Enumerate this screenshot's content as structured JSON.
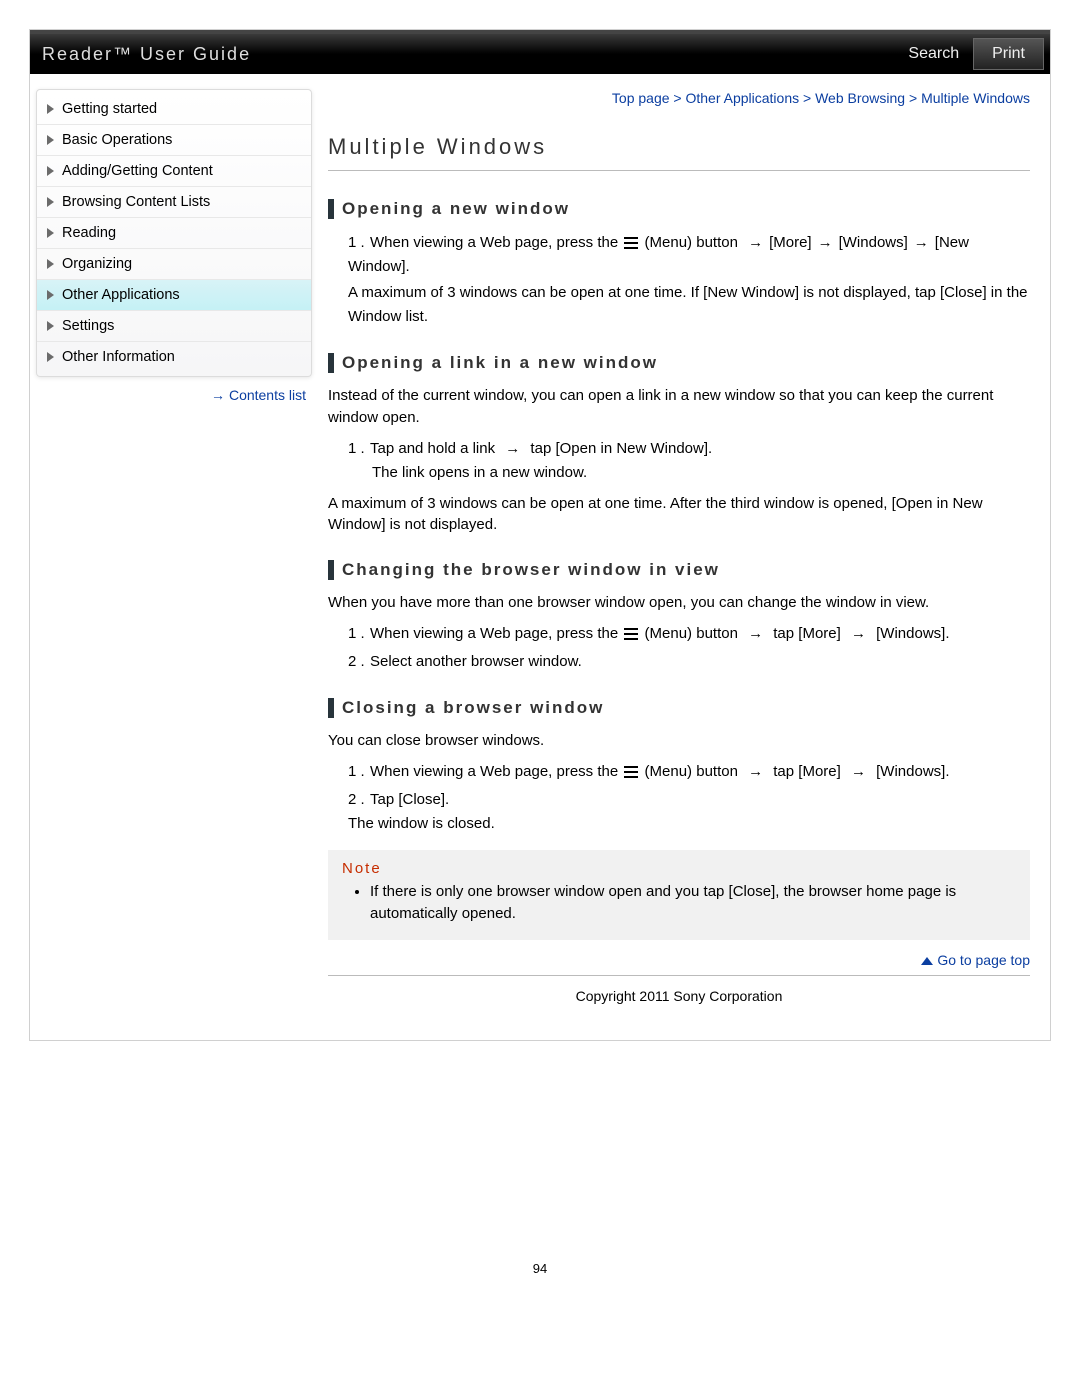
{
  "header": {
    "title": "Reader™ User Guide",
    "search": "Search",
    "print": "Print"
  },
  "breadcrumb": {
    "p0": "Top page",
    "p1": "Other Applications",
    "p2": "Web Browsing",
    "p3": "Multiple Windows",
    "sep": " > "
  },
  "nav": {
    "items": [
      {
        "label": "Getting started"
      },
      {
        "label": "Basic Operations"
      },
      {
        "label": "Adding/Getting Content"
      },
      {
        "label": "Browsing Content Lists"
      },
      {
        "label": "Reading"
      },
      {
        "label": "Organizing"
      },
      {
        "label": "Other Applications"
      },
      {
        "label": "Settings"
      },
      {
        "label": "Other Information"
      }
    ],
    "contents_list": "Contents list"
  },
  "main": {
    "title": "Multiple Windows",
    "s1": {
      "h": "Opening a new window",
      "step1a": "When viewing a Web page, press the ",
      "step1b": " (Menu) button ",
      "more": "[More]",
      "windows": "[Windows]",
      "newwin": "[New Window].",
      "after": "A maximum of 3 windows can be open at one time. If [New Window] is not displayed, tap [Close] in the Window list."
    },
    "s2": {
      "h": "Opening a link in a new window",
      "intro": "Instead of the current window, you can open a link in a new window so that you can keep the current window open.",
      "step1a": "Tap and hold a link ",
      "step1b": " tap [Open in New Window].",
      "sub": "The link opens in a new window.",
      "after": "A maximum of 3 windows can be open at one time. After the third window is opened, [Open in New Window] is not displayed."
    },
    "s3": {
      "h": "Changing the browser window in view",
      "intro": "When you have more than one browser window open, you can change the window in view.",
      "step1a": "When viewing a Web page, press the ",
      "step1b": " (Menu) button ",
      "tapmore": " tap [More] ",
      "windows": " [Windows].",
      "step2": "Select another browser window."
    },
    "s4": {
      "h": "Closing a browser window",
      "intro": "You can close browser windows.",
      "step1a": "When viewing a Web page, press the ",
      "step1b": " (Menu) button ",
      "tapmore": " tap [More] ",
      "windows": " [Windows].",
      "step2": "Tap [Close].",
      "sub": "The window is closed."
    },
    "note": {
      "label": "Note",
      "item": "If there is only one browser window open and you tap [Close], the browser home page is automatically opened."
    },
    "goto": "Go to page top",
    "copyright": "Copyright 2011 Sony Corporation",
    "pagenum": "94",
    "num1": "1 .",
    "num2": "2 ."
  }
}
